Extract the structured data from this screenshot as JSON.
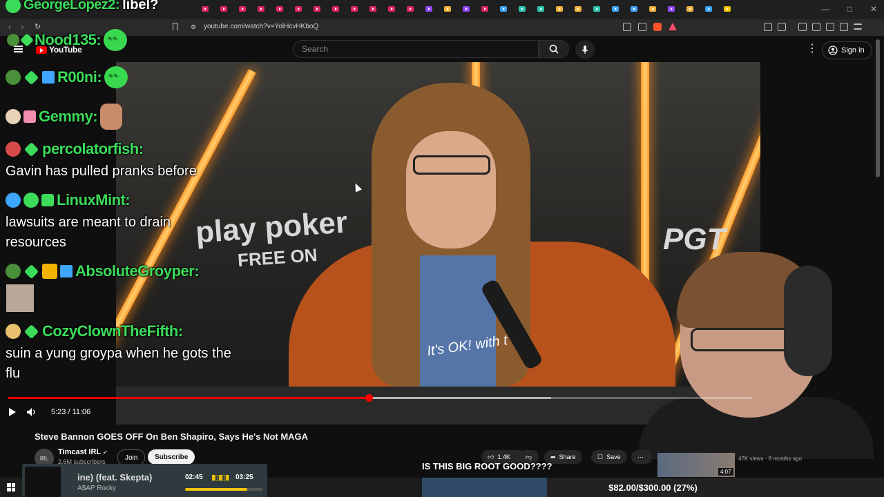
{
  "browser": {
    "url": "youtube.com/watch?v=YolHcvHKboQ",
    "tab_colors": [
      "#e0245e",
      "#e0245e",
      "#e0245e",
      "#e0245e",
      "#e0245e",
      "#e0245e",
      "#e0245e",
      "#e0245e",
      "#e0245e",
      "#e0245e",
      "#e0245e",
      "#e0245e",
      "#9146ff",
      "#f2b33d",
      "#9146ff",
      "#e0245e",
      "#3ea6ff",
      "#2bc4b0",
      "#2bc4b0",
      "#f2b33d",
      "#f2b33d",
      "#2bc4b0",
      "#3ea6ff",
      "#3ea6ff",
      "#f2b33d",
      "#9146ff",
      "#f2b33d",
      "#3ea6ff",
      "#f2c300"
    ]
  },
  "youtube": {
    "logo_text": "YouTube",
    "search_placeholder": "Search",
    "signin_label": "Sign in"
  },
  "video": {
    "brand_left": "play poker",
    "brand_left_sub": "FREE ON",
    "brand_right": "PGT",
    "shirt_text": "It's OK! with t",
    "current_time": "5:23",
    "duration": "11:06",
    "time_display": "5:23 / 11:06",
    "progress_played": 0.485,
    "progress_buffered": 0.73
  },
  "details": {
    "title": "Steve Bannon GOES OFF On Ben Shapiro, Says He's Not MAGA",
    "channel": "Timcast IRL",
    "subscribers": "2.6M subscribers",
    "avatar_text": "IRL",
    "join_label": "Join",
    "subscribe_label": "Subscribe",
    "likes": "1.4K",
    "share_label": "Share",
    "save_label": "Save",
    "rec_views": "47K views · 8 months ago",
    "rec_duration": "4:07"
  },
  "chat": [
    {
      "user": "GeorgeLopez2:",
      "message": "libel?"
    },
    {
      "user": "Nood135:",
      "message": ""
    },
    {
      "user": "R00ni:",
      "message": ""
    },
    {
      "user": "Gemmy:",
      "message": ""
    },
    {
      "user": "percolatorfish:",
      "message": "Gavin has pulled pranks before"
    },
    {
      "user": "LinuxMint:",
      "message": "lawsuits are meant to drain resources"
    },
    {
      "user": "AbsoluteGroyper:",
      "message": ""
    },
    {
      "user": "CozyClownTheFifth:",
      "message": "suin a yung groypa when he gots the flu"
    }
  ],
  "now_playing": {
    "title": "ine) (feat. Skepta)",
    "artist": "A$AP Rocky",
    "elapsed": "02:45",
    "total": "03:25",
    "progress": 0.805
  },
  "overlay": {
    "caption": "IS THIS BIG ROOT GOOD????",
    "goal_text": "$82.00/$300.00 (27%)",
    "goal_progress": 0.27
  }
}
